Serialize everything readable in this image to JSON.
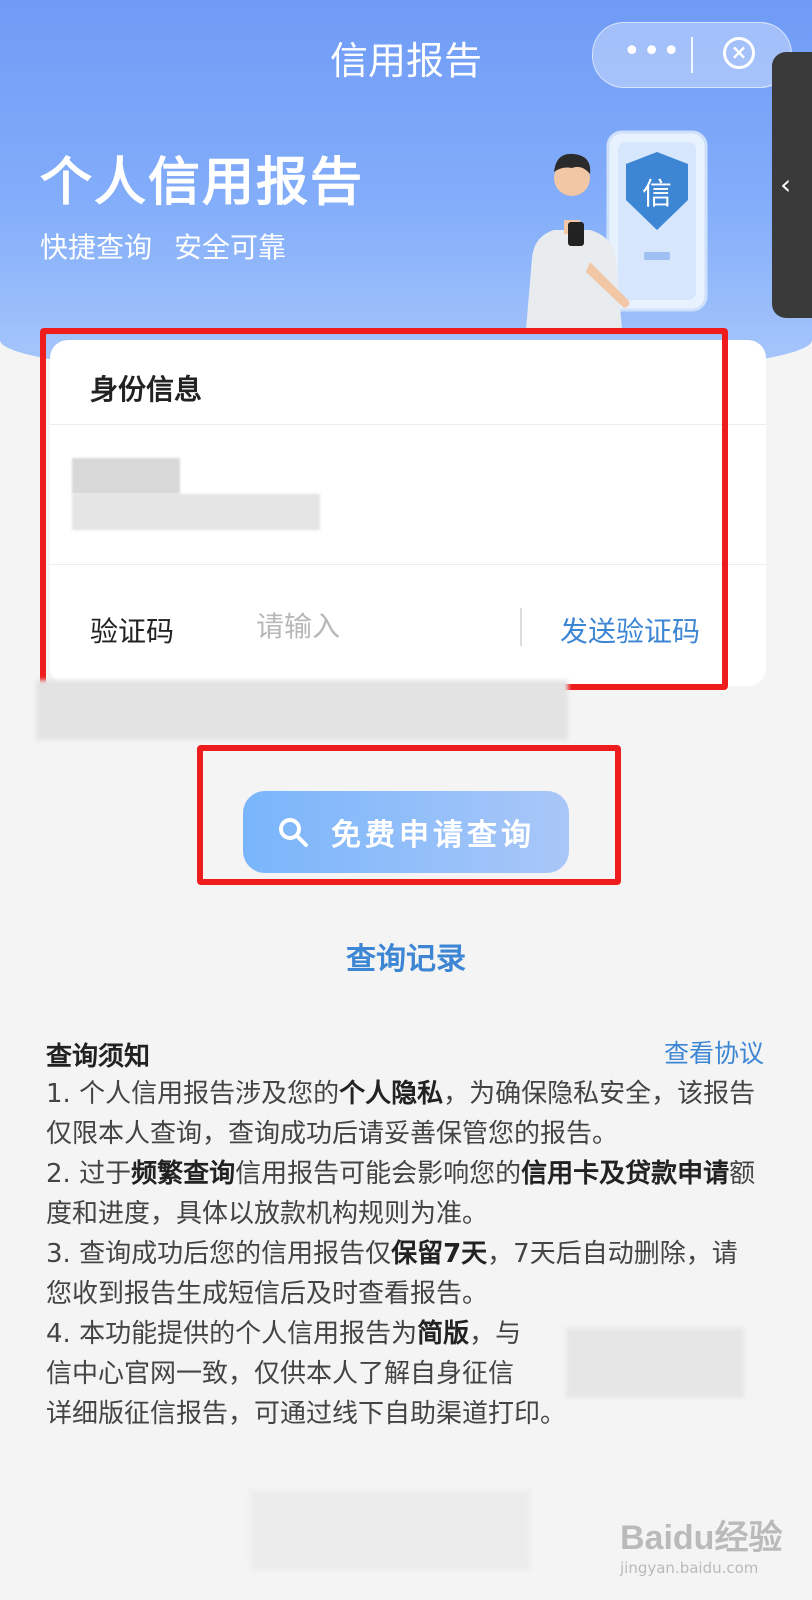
{
  "header": {
    "title": "信用报告",
    "more_glyph": "•••",
    "close_glyph": "×"
  },
  "hero": {
    "title": "个人信用报告",
    "tag1": "快捷查询",
    "tag2": "安全可靠",
    "badge_char": "信"
  },
  "identity_card": {
    "heading": "身份信息",
    "verification_label": "验证码",
    "verification_placeholder": "请输入",
    "send_code_label": "发送验证码"
  },
  "query_button_label": "免费申请查询",
  "records_link": "查询记录",
  "notice": {
    "title": "查询须知",
    "agreement_link": "查看协议",
    "items": [
      {
        "text_a": "1. 个人信用报告涉及您的",
        "bold_a": "个人隐私",
        "text_b": "，为确保隐私安全，该报告仅限本人查询，查询成功后请妥善保管您的报告。"
      },
      {
        "text_a": "2. 过于",
        "bold_a": "频繁查询",
        "text_b": "信用报告可能会影响您的",
        "bold_b": "信用卡及贷款申请",
        "text_c": "额度和进度，具体以放款机构规则为准。"
      },
      {
        "text_a": "3. 查询成功后您的信用报告仅",
        "bold_a": "保留7天",
        "text_b": "，7天后自动删除，请您收到报告生成短信后及时查看报告。"
      },
      {
        "text_a": "4. 本功能提供的个人信用报告为",
        "bold_a": "简版",
        "text_b": "，与",
        "text_c": "信中心官网一致，仅供本人了解自身征信",
        "text_d": "详细版征信报告，可通过线下自助渠道打印。"
      }
    ]
  },
  "watermark": {
    "main": "Baidu经验",
    "sub": "jingyan.baidu.com"
  },
  "colors": {
    "accent_blue": "#3d86d4",
    "annotation_red": "#ee1c1c",
    "hero_blue": "#6f9bf6"
  }
}
